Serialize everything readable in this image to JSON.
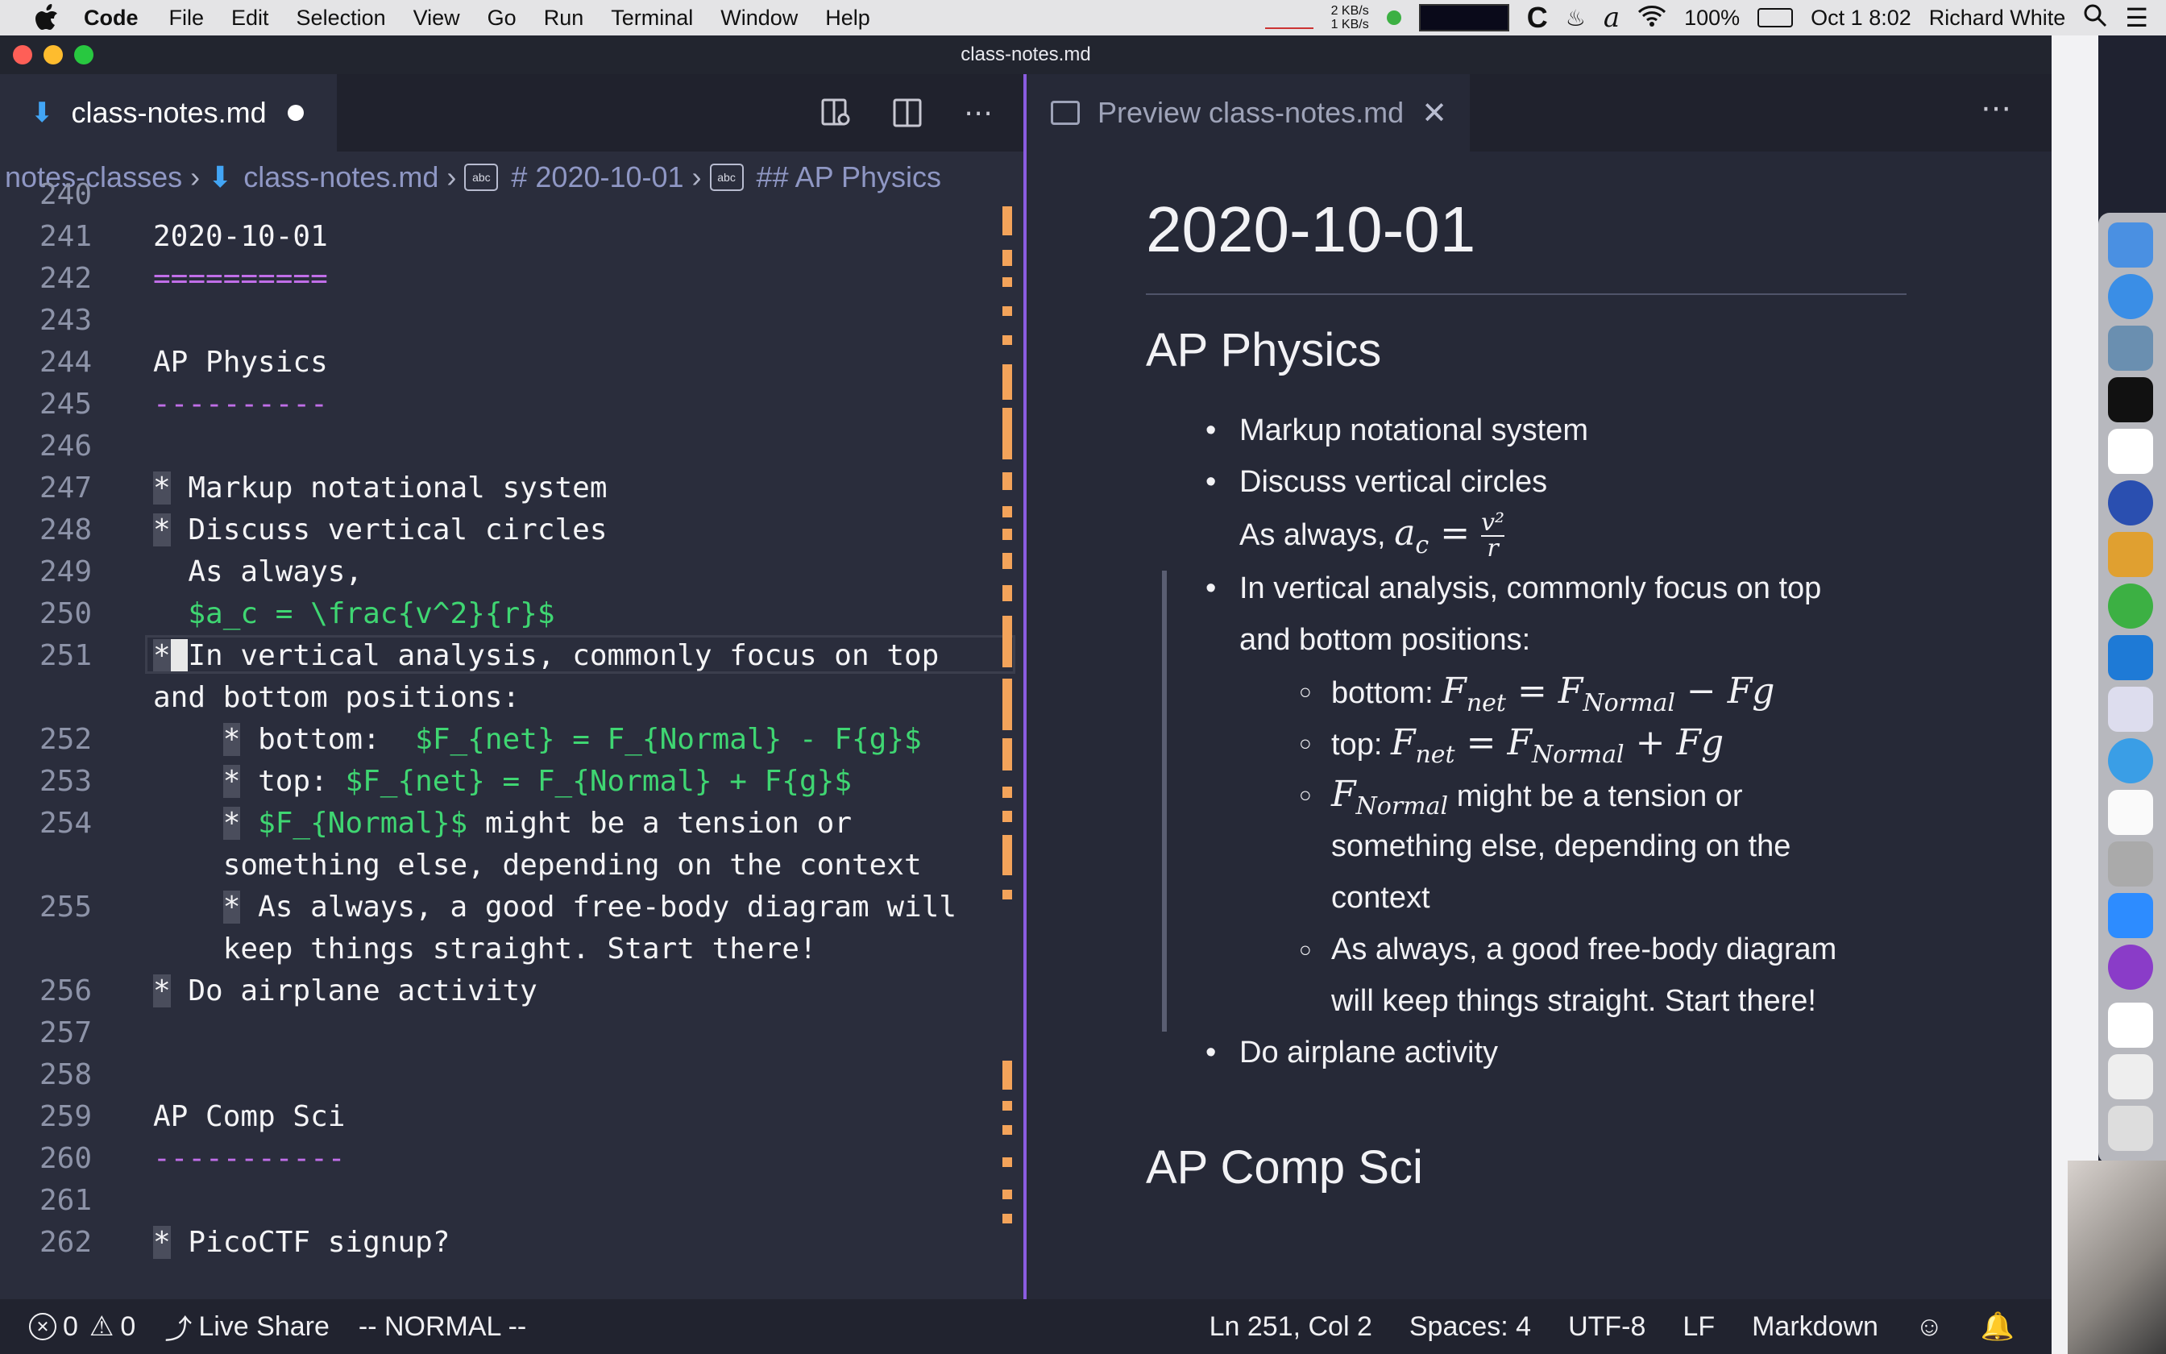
{
  "menubar": {
    "app": "Code",
    "menus": [
      "File",
      "Edit",
      "Selection",
      "View",
      "Go",
      "Run",
      "Terminal",
      "Window",
      "Help"
    ],
    "net_up": "2 KB/s",
    "net_down": "1 KB/s",
    "battery": "100%",
    "datetime": "Oct 1  8:02",
    "user": "Richard White"
  },
  "window": {
    "title": "class-notes.md"
  },
  "editor": {
    "tab_label": "class-notes.md",
    "breadcrumb": [
      "notes-classes",
      "class-notes.md",
      "# 2020-10-01",
      "## AP Physics"
    ],
    "lines": [
      {
        "n": "240",
        "t": ""
      },
      {
        "n": "241",
        "t": "2020-10-01"
      },
      {
        "n": "242",
        "t": "=========="
      },
      {
        "n": "243",
        "t": ""
      },
      {
        "n": "244",
        "t": "AP Physics"
      },
      {
        "n": "245",
        "t": "----------"
      },
      {
        "n": "246",
        "t": ""
      },
      {
        "n": "247",
        "t": "* Markup notational system"
      },
      {
        "n": "248",
        "t": "* Discuss vertical circles"
      },
      {
        "n": "249",
        "t": "  As always,"
      },
      {
        "n": "250",
        "t": "  $a_c = \\frac{v^2}{r}$"
      },
      {
        "n": "251",
        "t": "* In vertical analysis, commonly focus on top"
      },
      {
        "n": "",
        "t": "and bottom positions:"
      },
      {
        "n": "252",
        "t": "    * bottom:  $F_{net} = F_{Normal} - F{g}$"
      },
      {
        "n": "253",
        "t": "    * top: $F_{net} = F_{Normal} + F{g}$"
      },
      {
        "n": "254",
        "t": "    * $F_{Normal}$ might be a tension or"
      },
      {
        "n": "",
        "t": "    something else, depending on the context"
      },
      {
        "n": "255",
        "t": "    * As always, a good free-body diagram will"
      },
      {
        "n": "",
        "t": "    keep things straight. Start there!"
      },
      {
        "n": "256",
        "t": "* Do airplane activity"
      },
      {
        "n": "257",
        "t": ""
      },
      {
        "n": "258",
        "t": ""
      },
      {
        "n": "259",
        "t": "AP Comp Sci"
      },
      {
        "n": "260",
        "t": "-----------"
      },
      {
        "n": "261",
        "t": ""
      },
      {
        "n": "262",
        "t": "* PicoCTF signup?"
      }
    ]
  },
  "preview": {
    "tab_label": "Preview class-notes.md",
    "h1": "2020-10-01",
    "h2_physics": "AP Physics",
    "b1": "Markup notational system",
    "b2": "Discuss vertical circles",
    "b2_cont": "As always,",
    "b3_l1": "In vertical analysis, commonly focus on top",
    "b3_l2": "and bottom positions:",
    "sub_bottom": "bottom:",
    "sub_top": "top:",
    "sub3_l1": "might be a tension or",
    "sub3_l2": "something else, depending on the",
    "sub3_l3": "context",
    "sub4_l1": "As always, a good free-body diagram",
    "sub4_l2": "will keep things straight. Start there!",
    "b4": "Do airplane activity",
    "h2_compsci": "AP Comp Sci"
  },
  "statusbar": {
    "errors": "0",
    "warnings": "0",
    "live_share": "Live Share",
    "mode": "-- NORMAL --",
    "position": "Ln 251, Col 2",
    "spaces": "Spaces: 4",
    "encoding": "UTF-8",
    "eol": "LF",
    "language": "Markdown"
  },
  "colors": {
    "accent": "#8a5ce0",
    "math": "#3fd672",
    "heading_underline": "#c06ee8",
    "scroll_marker": "#f3a35a"
  }
}
